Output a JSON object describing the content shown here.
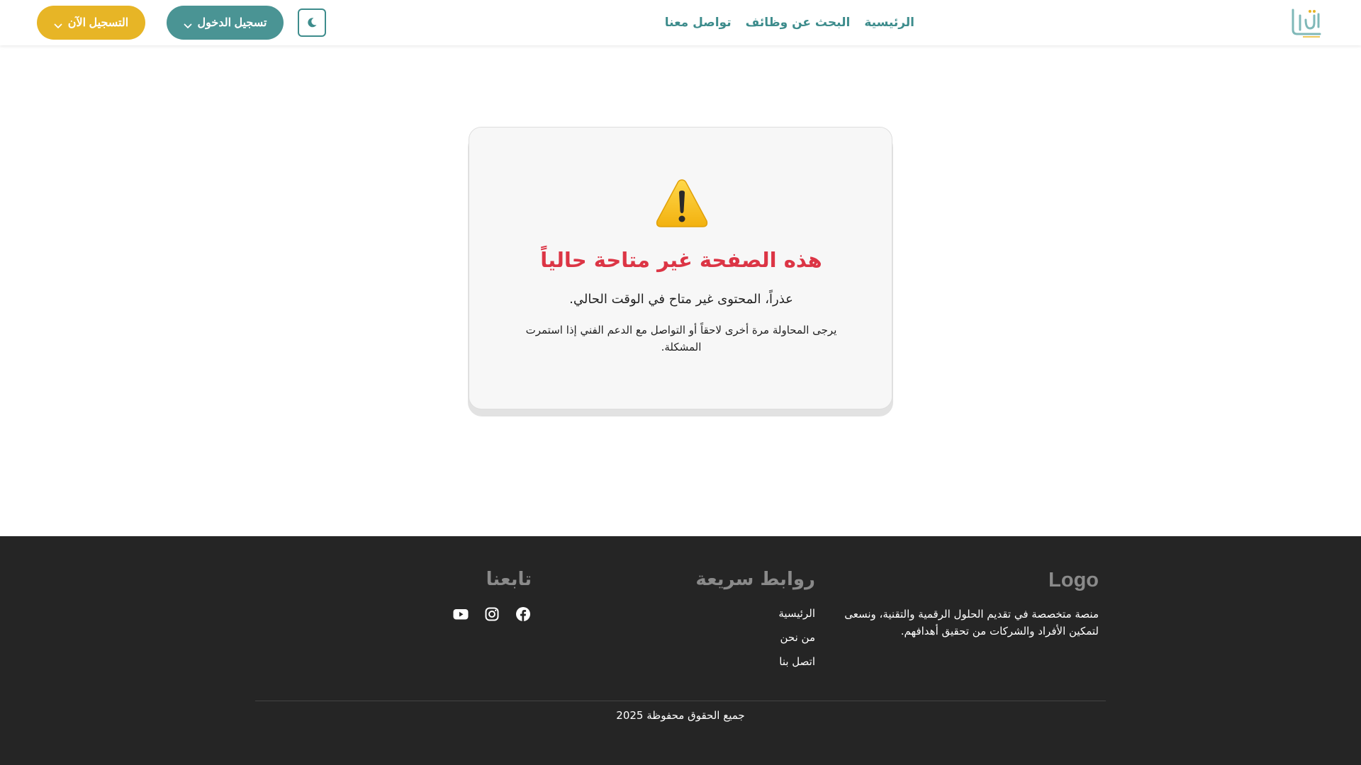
{
  "colors": {
    "primary": "#4a9494",
    "link": "#3d8c8c",
    "accent": "#e7b526",
    "error": "#dc3545",
    "footer_bg": "#252525",
    "card_bg": "#f7f7f7"
  },
  "header": {
    "logo_icon": "brand-logo",
    "nav": [
      {
        "label": "الرئيسية"
      },
      {
        "label": "البحث عن وظائف"
      },
      {
        "label": "تواصل معنا"
      }
    ],
    "theme_toggle_icon": "moon-icon",
    "login_label": "تسجيل الدخول",
    "register_label": "التسجيل الآن"
  },
  "main": {
    "icon": "warning-icon",
    "title": "هذه الصفحة غير متاحة حالياً",
    "subtitle": "عذراً، المحتوى غير متاح في الوقت الحالي.",
    "text": "يرجى المحاولة مرة أخرى لاحقاً أو التواصل مع الدعم الفني إذا استمرت المشكلة."
  },
  "footer": {
    "about": {
      "heading": "Logo",
      "text": "منصة متخصصة في تقديم الحلول الرقمية والتقنية، ونسعى لتمكين الأفراد والشركات من تحقيق أهدافهم."
    },
    "quick_links": {
      "heading": "روابط سريعة",
      "items": [
        {
          "label": "الرئيسية"
        },
        {
          "label": "من نحن"
        },
        {
          "label": "اتصل بنا"
        }
      ]
    },
    "follow": {
      "heading": "تابعنا",
      "icons": [
        "facebook-icon",
        "instagram-icon",
        "youtube-icon"
      ]
    },
    "copyright": "جميع الحقوق محفوظة 2025"
  }
}
